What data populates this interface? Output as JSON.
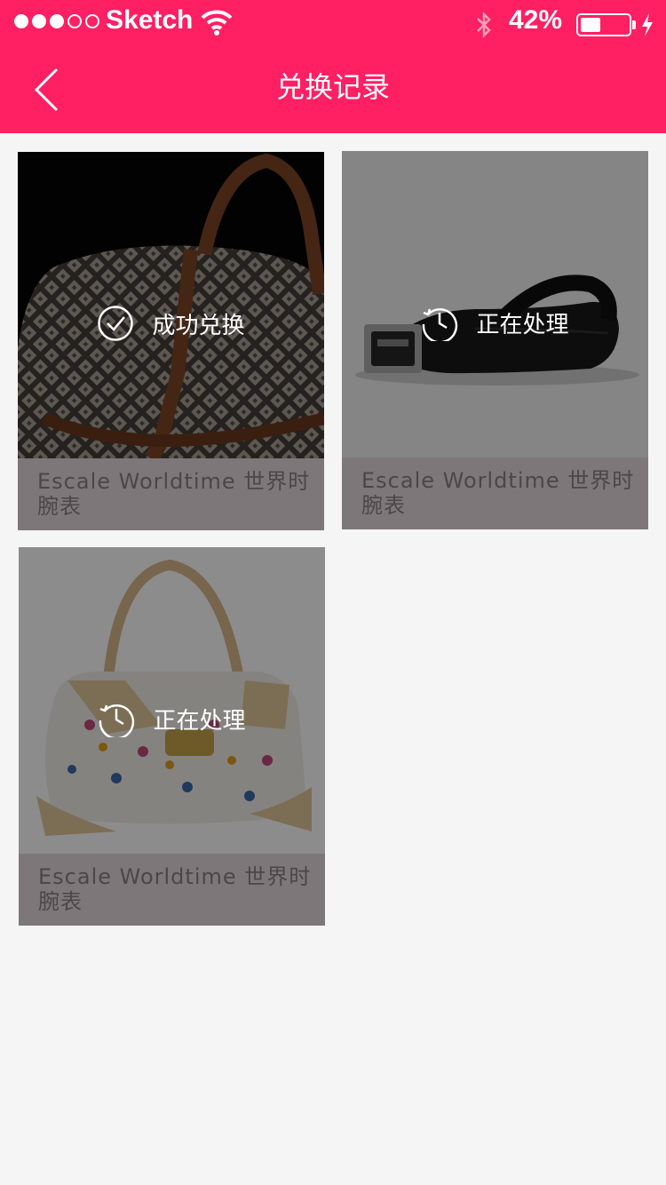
{
  "status_bar": {
    "carrier": "Sketch",
    "battery_percent_text": "42%",
    "battery_level": 0.42,
    "signal_bars_filled": 3,
    "signal_bars_total": 5
  },
  "nav": {
    "back_icon": "chevron-left-icon",
    "title": "兑换记录"
  },
  "colors": {
    "accent": "#ff1f63",
    "background": "#f5f5f5",
    "card_caption": "#7e7779"
  },
  "records": [
    {
      "status": "成功兑换",
      "status_icon": "check-circle-icon",
      "name": "Escale Worldtime 世界时腕表",
      "image": "monogram-tote-bag"
    },
    {
      "status": "正在处理",
      "status_icon": "history-clock-icon",
      "name": "Escale Worldtime 世界时腕表",
      "image": "black-leather-belt"
    },
    {
      "status": "正在处理",
      "status_icon": "history-clock-icon",
      "name": "Escale Worldtime 世界时腕表",
      "image": "multicolor-monogram-handbag"
    }
  ]
}
